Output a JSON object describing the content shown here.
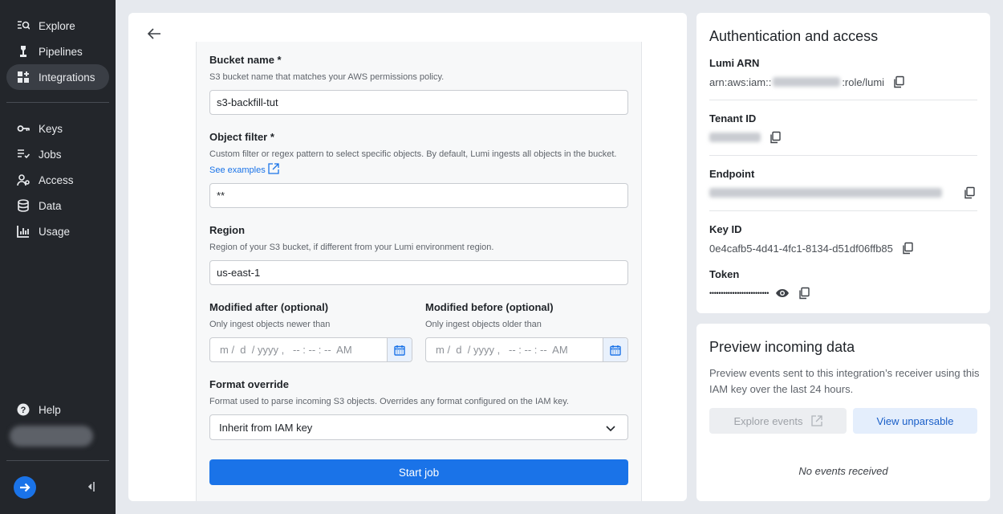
{
  "sidebar": {
    "items": [
      {
        "label": "Explore",
        "icon": "explore-icon"
      },
      {
        "label": "Pipelines",
        "icon": "pipelines-icon"
      },
      {
        "label": "Integrations",
        "icon": "integrations-icon",
        "active": true
      },
      {
        "label": "Keys",
        "icon": "key-icon"
      },
      {
        "label": "Jobs",
        "icon": "jobs-icon"
      },
      {
        "label": "Access",
        "icon": "access-icon"
      },
      {
        "label": "Data",
        "icon": "data-icon"
      },
      {
        "label": "Usage",
        "icon": "usage-icon"
      }
    ],
    "help_label": "Help"
  },
  "form": {
    "bucket": {
      "label": "Bucket name *",
      "help": "S3 bucket name that matches your AWS permissions policy.",
      "value": "s3-backfill-tut"
    },
    "filter": {
      "label": "Object filter *",
      "help": "Custom filter or regex pattern to select specific objects. By default, Lumi ingests all objects in the bucket.",
      "link": "See examples",
      "value": "**"
    },
    "region": {
      "label": "Region",
      "help": "Region of your S3 bucket, if different from your Lumi environment region.",
      "value": "us-east-1"
    },
    "modified_after": {
      "label": "Modified after (optional)",
      "help": "Only ingest objects newer than",
      "placeholder": "m /  d  / yyyy ,   -- : -- : --  AM"
    },
    "modified_before": {
      "label": "Modified before (optional)",
      "help": "Only ingest objects older than",
      "placeholder": "m /  d  / yyyy ,   -- : -- : --  AM"
    },
    "format": {
      "label": "Format override",
      "help": "Format used to parse incoming S3 objects. Overrides any format configured on the IAM key.",
      "value": "Inherit from IAM key"
    },
    "submit_label": "Start job"
  },
  "auth": {
    "title": "Authentication and access",
    "arn_label": "Lumi ARN",
    "arn_prefix": "arn:aws:iam::",
    "arn_suffix": ":role/lumi",
    "tenant_label": "Tenant ID",
    "endpoint_label": "Endpoint",
    "key_id_label": "Key ID",
    "key_id_value": "0e4cafb5-4d41-4fc1-8134-d51df06ffb85",
    "token_label": "Token",
    "token_value": "••••••••••••••••••••••••••"
  },
  "preview": {
    "title": "Preview incoming data",
    "description": "Preview events sent to this integration’s receiver using this IAM key over the last 24 hours.",
    "explore_label": "Explore events",
    "unparsable_label": "View unparsable",
    "empty_message": "No events received"
  },
  "colors": {
    "accent": "#1a73e8",
    "sidebar": "#23262b",
    "background": "#e6e9ee"
  }
}
